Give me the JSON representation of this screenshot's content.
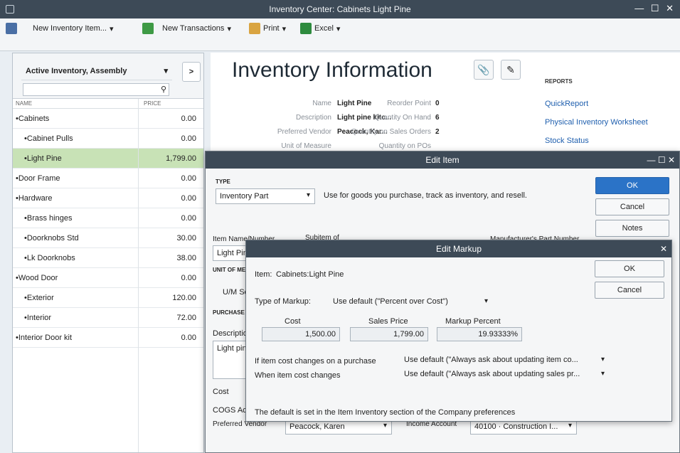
{
  "window": {
    "title": "Inventory Center: Cabinets Light Pine",
    "controls": "— ☐ ✕"
  },
  "toolbar": {
    "new_item": "New Inventory Item...",
    "new_transactions": "New Transactions",
    "print": "Print",
    "excel": "Excel"
  },
  "left": {
    "filter": "Active Inventory, Assembly",
    "col_name": "NAME",
    "col_price": "PRICE",
    "items": [
      {
        "name": "•Cabinets",
        "price": "0.00",
        "indent": 0
      },
      {
        "name": "•Cabinet Pulls",
        "price": "0.00",
        "indent": 1
      },
      {
        "name": "•Light Pine",
        "price": "1,799.00",
        "indent": 1,
        "selected": true
      },
      {
        "name": "•Door Frame",
        "price": "0.00",
        "indent": 0
      },
      {
        "name": "•Hardware",
        "price": "0.00",
        "indent": 0
      },
      {
        "name": "•Brass hinges",
        "price": "0.00",
        "indent": 1
      },
      {
        "name": "•Doorknobs Std",
        "price": "30.00",
        "indent": 1
      },
      {
        "name": "•Lk Doorknobs",
        "price": "38.00",
        "indent": 1
      },
      {
        "name": "•Wood Door",
        "price": "0.00",
        "indent": 0
      },
      {
        "name": "•Exterior",
        "price": "120.00",
        "indent": 1
      },
      {
        "name": "•Interior",
        "price": "72.00",
        "indent": 1
      },
      {
        "name": "•Interior Door kit",
        "price": "0.00",
        "indent": 0
      }
    ]
  },
  "info": {
    "title": "Inventory Information",
    "name_label": "Name",
    "name": "Light Pine",
    "desc_label": "Description",
    "desc": "Light pine kitc...",
    "vendor_label": "Preferred Vendor",
    "vendor": "Peacock, Kar...",
    "uom_label": "Unit of Measure",
    "reorder_label": "Reorder Point",
    "reorder": "0",
    "onhand_label": "Quantity On Hand",
    "onhand": "6",
    "sales_orders_label": "Quantity on Sales Orders",
    "sales_orders": "2",
    "pos_label": "Quantity on POs",
    "reports_head": "REPORTS",
    "reports": [
      "QuickReport",
      "Physical Inventory Worksheet",
      "Stock Status"
    ]
  },
  "edit_item": {
    "title": "Edit Item",
    "type_label": "TYPE",
    "type_value": "Inventory Part",
    "type_desc": "Use for goods you purchase, track as inventory, and resell.",
    "ok": "OK",
    "cancel": "Cancel",
    "notes": "Notes",
    "item_name_label": "Item Name/Number",
    "subitem_label": "Subitem of",
    "mfr_label": "Manufacturer's Part Number",
    "item_name_value": "Light Pine",
    "uom_label": "UNIT OF MEASURE",
    "uom_value": "U/M Set",
    "purchase_label": "PURCHASE INFORMATION",
    "desc_label": "Description",
    "desc_value": "Light pine kitchen cabinet #CLD-",
    "cost_label": "Cost",
    "cogs_label": "COGS Account",
    "pref_vendor_label": "Preferred Vendor",
    "pref_vendor_value": "Peacock, Karen",
    "income_label": "Income Account",
    "income_value": "40100 · Construction I..."
  },
  "edit_markup": {
    "title": "Edit Markup",
    "item_label": "Item:",
    "item_value": "Cabinets:Light Pine",
    "ok": "OK",
    "cancel": "Cancel",
    "type_label": "Type of Markup:",
    "type_value": "Use default (\"Percent over Cost\")",
    "cost_label": "Cost",
    "cost_value": "1,500.00",
    "sales_label": "Sales Price",
    "sales_value": "1,799.00",
    "markup_label": "Markup Percent",
    "markup_value": "19.93333%",
    "purchase_label": "If item cost changes on a purchase",
    "purchase_value": "Use default (\"Always ask about updating item co...",
    "change_label": "When item cost changes",
    "change_value": "Use default (\"Always ask about updating sales pr...",
    "footer": "The default is set in the Item Inventory section of the Company preferences"
  }
}
